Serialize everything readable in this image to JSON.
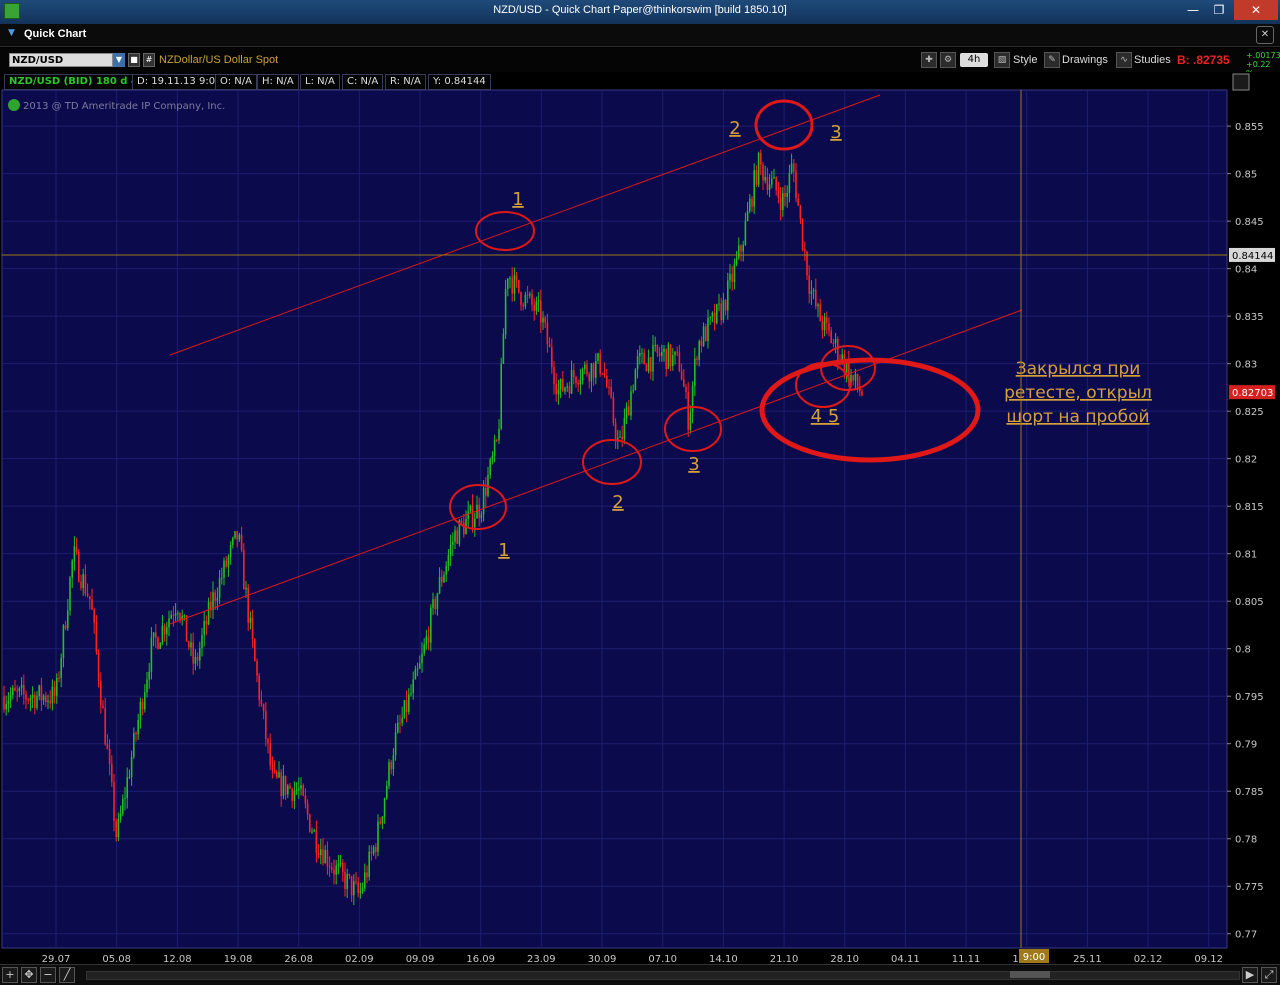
{
  "window": {
    "title": "NZD/USD - Quick Chart Paper@thinkorswim [build 1850.10]",
    "minimize": "—",
    "maximize": "❐",
    "close": "✕"
  },
  "panel": {
    "title": "Quick Chart",
    "close": "✕"
  },
  "toolbar": {
    "symbol": "NZD/USD",
    "description": "NZDollar/US Dollar Spot",
    "aggregation": "4h",
    "style": "Style",
    "drawings": "Drawings",
    "studies": "Studies",
    "bid": "B: .82735",
    "change_abs": "+.00173",
    "change_pct": "+0.22 %"
  },
  "infobar": {
    "chart_name": "NZD/USD (BID) 180 d 4h",
    "d": "D: 19.11.13 9:00",
    "o": "O: N/A",
    "h": "H: N/A",
    "l": "L: N/A",
    "c": "C: N/A",
    "r": "R: N/A",
    "y": "Y: 0.84144"
  },
  "chart_data": {
    "type": "candlestick",
    "copyright": "2013 @ TD Ameritrade IP Company, Inc.",
    "x_tick_labels": [
      "29.07",
      "05.08",
      "12.08",
      "19.08",
      "26.08",
      "02.09",
      "09.09",
      "16.09",
      "23.09",
      "30.09",
      "07.10",
      "14.10",
      "21.10",
      "28.10",
      "04.11",
      "11.11",
      "18.11",
      "25.11",
      "02.12",
      "09.12"
    ],
    "y_tick_labels": [
      "0.855",
      "0.85",
      "0.845",
      "0.84",
      "0.835",
      "0.83",
      "0.825",
      "0.82",
      "0.815",
      "0.81",
      "0.805",
      "0.8",
      "0.795",
      "0.79",
      "0.785",
      "0.78",
      "0.775",
      "0.77"
    ],
    "ylim": [
      0.7685,
      0.8588
    ],
    "cursor": {
      "price": 0.84144,
      "label": "0.84144",
      "time_label": "9:00"
    },
    "last_price": {
      "price": 0.827,
      "label": "0.82703"
    },
    "closes": [
      {
        "date": "29.07",
        "close": 0.795
      },
      {
        "date": "31.07",
        "close": 0.81
      },
      {
        "date": "02.08",
        "close": 0.805
      },
      {
        "date": "05.08",
        "close": 0.78
      },
      {
        "date": "07.08",
        "close": 0.79
      },
      {
        "date": "09.08",
        "close": 0.8
      },
      {
        "date": "12.08",
        "close": 0.805
      },
      {
        "date": "14.08",
        "close": 0.798
      },
      {
        "date": "16.08",
        "close": 0.805
      },
      {
        "date": "19.08",
        "close": 0.812
      },
      {
        "date": "21.08",
        "close": 0.798
      },
      {
        "date": "23.08",
        "close": 0.786
      },
      {
        "date": "26.08",
        "close": 0.785
      },
      {
        "date": "28.08",
        "close": 0.78
      },
      {
        "date": "30.08",
        "close": 0.777
      },
      {
        "date": "02.09",
        "close": 0.774
      },
      {
        "date": "04.09",
        "close": 0.78
      },
      {
        "date": "06.09",
        "close": 0.79
      },
      {
        "date": "09.09",
        "close": 0.798
      },
      {
        "date": "11.09",
        "close": 0.806
      },
      {
        "date": "13.09",
        "close": 0.812
      },
      {
        "date": "16.09",
        "close": 0.815
      },
      {
        "date": "18.09",
        "close": 0.822
      },
      {
        "date": "19.09",
        "close": 0.84
      },
      {
        "date": "20.09",
        "close": 0.838
      },
      {
        "date": "23.09",
        "close": 0.835
      },
      {
        "date": "25.09",
        "close": 0.827
      },
      {
        "date": "27.09",
        "close": 0.829
      },
      {
        "date": "30.09",
        "close": 0.83
      },
      {
        "date": "02.10",
        "close": 0.821
      },
      {
        "date": "04.10",
        "close": 0.83
      },
      {
        "date": "07.10",
        "close": 0.831
      },
      {
        "date": "09.10",
        "close": 0.83
      },
      {
        "date": "10.10",
        "close": 0.824
      },
      {
        "date": "11.10",
        "close": 0.832
      },
      {
        "date": "14.10",
        "close": 0.836
      },
      {
        "date": "16.10",
        "close": 0.842
      },
      {
        "date": "18.10",
        "close": 0.851
      },
      {
        "date": "21.10",
        "close": 0.847
      },
      {
        "date": "22.10",
        "close": 0.851
      },
      {
        "date": "23.10",
        "close": 0.844
      },
      {
        "date": "24.10",
        "close": 0.838
      },
      {
        "date": "25.10",
        "close": 0.835
      },
      {
        "date": "28.10",
        "close": 0.83
      },
      {
        "date": "29.10",
        "close": 0.828
      },
      {
        "date": "30.10",
        "close": 0.827
      }
    ],
    "annotations": {
      "upper_labels": [
        "1",
        "2",
        "3"
      ],
      "lower_labels": [
        "1",
        "2",
        "3"
      ],
      "retest_label": "4 5",
      "note": [
        "Закрылся при",
        "ретесте, открыл",
        "шорт на пробой"
      ]
    }
  },
  "colors": {
    "chart_bg": "#0b0a4c",
    "up": "#22c022",
    "down": "#ff2222",
    "annotation": "#e01818",
    "label": "#d4a03a",
    "grid": "#1c1e70",
    "cursor_line": "#a07a1a"
  }
}
